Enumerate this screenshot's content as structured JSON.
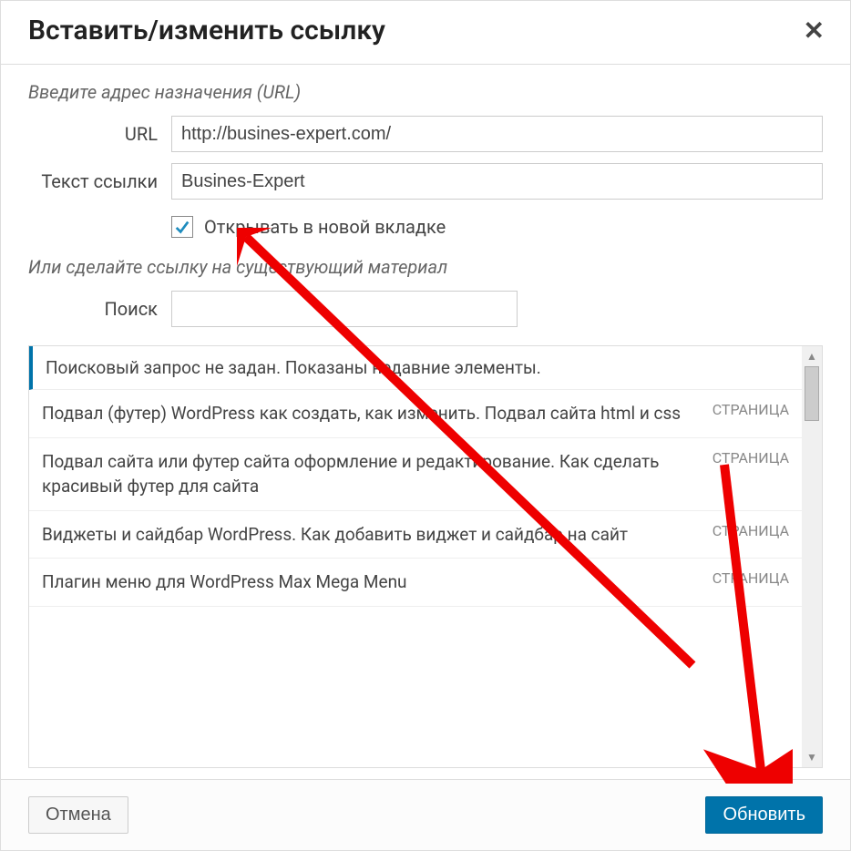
{
  "dialog": {
    "title": "Вставить/изменить ссылку"
  },
  "form": {
    "instruction": "Введите адрес назначения (URL)",
    "url_label": "URL",
    "url_value": "http://busines-expert.com/",
    "text_label": "Текст ссылки",
    "text_value": "Busines-Expert",
    "newtab_label": "Открывать в новой вкладке",
    "link_existing": "Или сделайте ссылку на существующий материал",
    "search_label": "Поиск",
    "search_value": ""
  },
  "results": {
    "header": "Поисковый запрос не задан. Показаны недавние элементы.",
    "items": [
      {
        "title": "Подвал (футер) WordPress как создать, как изменить. Подвал сайта html и css",
        "type": "СТРАНИЦА"
      },
      {
        "title": "Подвал сайта или футер сайта оформление и редактирование. Как сделать красивый футер для сайта",
        "type": "СТРАНИЦА"
      },
      {
        "title": "Виджеты и сайдбар WordPress. Как добавить виджет и сайдбар на сайт",
        "type": "СТРАНИЦА"
      },
      {
        "title": "Плагин меню для WordPress Max Mega Menu",
        "type": "СТРАНИЦА"
      }
    ]
  },
  "footer": {
    "cancel": "Отмена",
    "submit": "Обновить"
  }
}
